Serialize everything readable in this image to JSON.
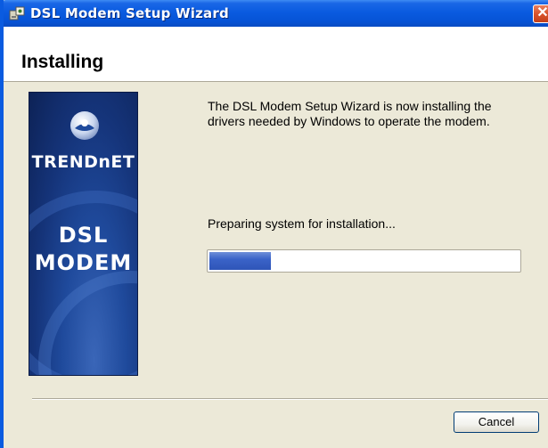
{
  "window": {
    "title": "DSL Modem Setup Wizard",
    "app_icon": "setup-wizard-icon",
    "close_glyph": "✕"
  },
  "header": {
    "title": "Installing"
  },
  "banner": {
    "brand": "TRENDnET",
    "line1": "DSL",
    "line2": "MODEM",
    "logo_icon": "trendnet-logo-icon"
  },
  "main": {
    "message": "The DSL Modem Setup Wizard is now installing the drivers needed by Windows to operate the modem.",
    "status": "Preparing system for installation...",
    "progress_percent": 20
  },
  "footer": {
    "cancel_label": "Cancel"
  },
  "colors": {
    "titlebar": "#0a5be0",
    "progress_fill": "#3a63c8",
    "window_bg": "#ece9d8"
  }
}
